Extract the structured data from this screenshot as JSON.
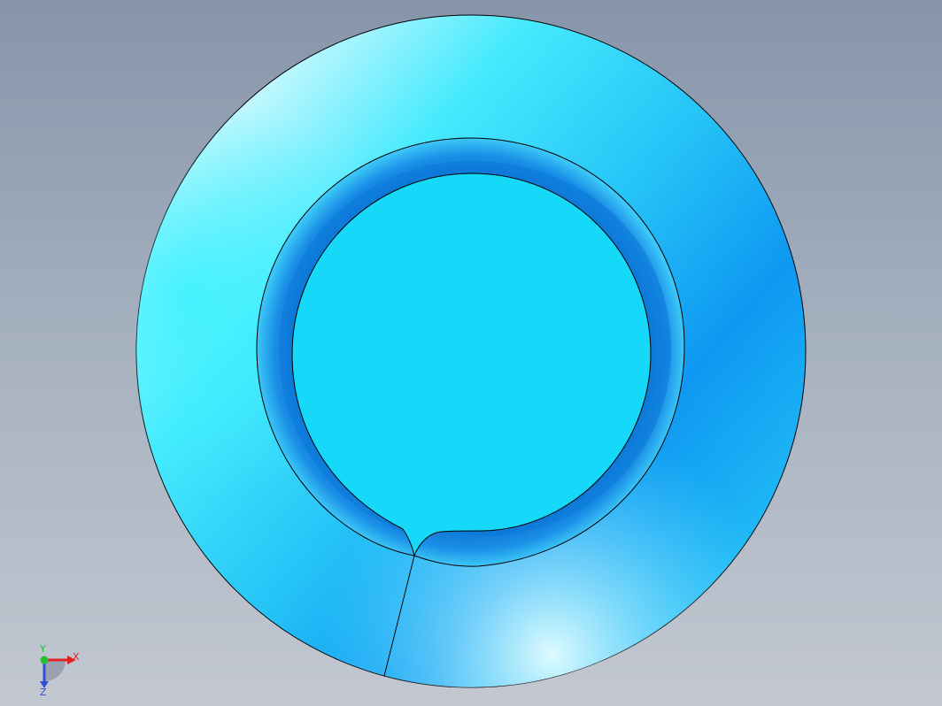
{
  "viewport": {
    "background_top": "#8795aa",
    "background_bottom": "#c3c8d1"
  },
  "model": {
    "part_color": "#16d8f8",
    "outer_face_colors": [
      "#e8fdff",
      "#3ff4ff",
      "#109ef5",
      "#1bcff6"
    ],
    "edge_color": "#000000"
  },
  "triad": {
    "x_label": "X",
    "y_label": "Y",
    "z_label": "Z",
    "x_color": "#e02424",
    "y_color": "#20c030",
    "z_color": "#3050d8"
  }
}
